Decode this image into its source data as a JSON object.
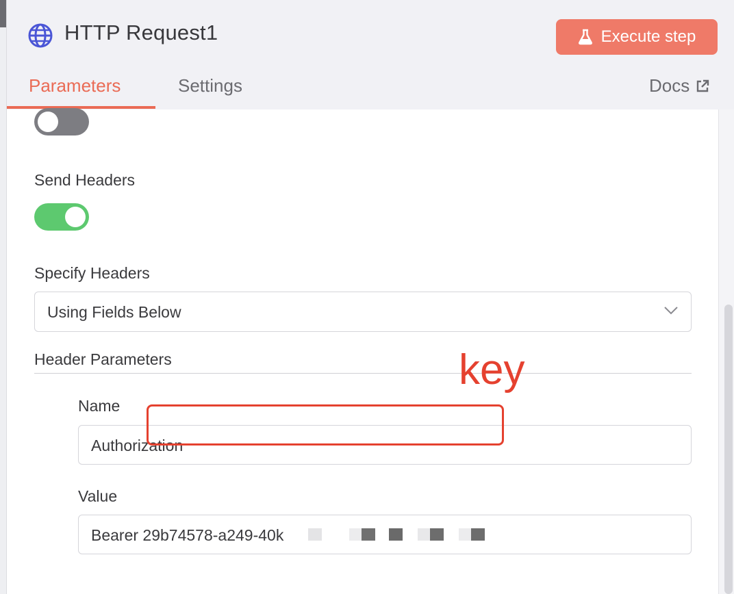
{
  "node": {
    "title": "HTTP Request1",
    "icon": "globe-icon",
    "execute_label": "Execute step",
    "execute_icon": "flask-icon",
    "accent": "#ef7a68"
  },
  "tabs": [
    {
      "label": "Parameters",
      "active": true
    },
    {
      "label": "Settings",
      "active": false
    }
  ],
  "docs": {
    "label": "Docs",
    "icon": "external-link-icon"
  },
  "params": {
    "toggle_top": {
      "on": false
    },
    "send_headers": {
      "label": "Send Headers",
      "on": true
    },
    "specify_headers": {
      "label": "Specify Headers",
      "value": "Using Fields Below"
    },
    "header_parameters": {
      "label": "Header Parameters"
    },
    "name": {
      "label": "Name",
      "value": "Authorization"
    },
    "value": {
      "label": "Value",
      "value": "Bearer 29b74578-a249-40k"
    }
  },
  "annotation": {
    "text": "key",
    "color": "#e5412f"
  }
}
